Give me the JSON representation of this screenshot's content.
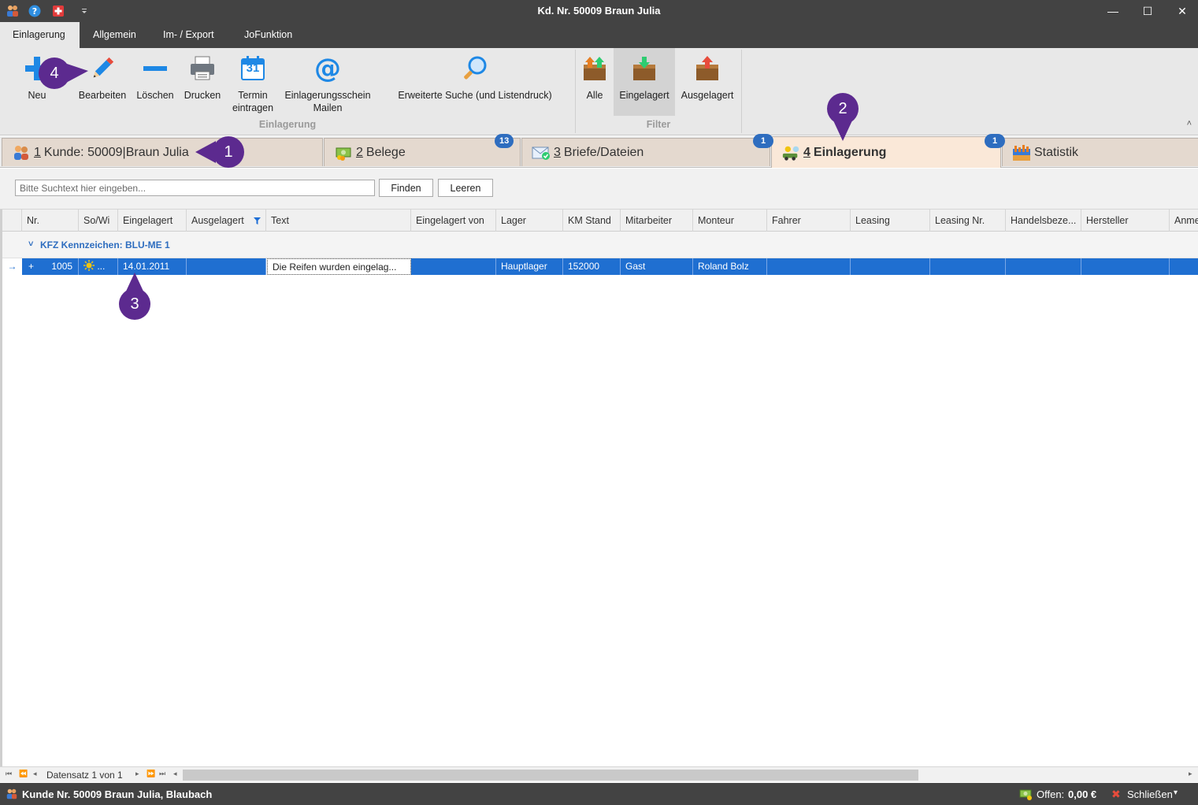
{
  "window": {
    "title": "Kd. Nr. 50009 Braun Julia",
    "minimize_glyph": "—",
    "maximize_glyph": "☐",
    "close_glyph": "✕"
  },
  "ribbon_tabs": [
    "Einlagerung",
    "Allgemein",
    "Im- / Export",
    "JoFunktion"
  ],
  "ribbon": {
    "group_einlagerung": {
      "label": "Einlagerung",
      "buttons": {
        "neu": "Neu",
        "bearbeiten": "Bearbeiten",
        "loeschen": "Löschen",
        "drucken": "Drucken",
        "termin_line1": "Termin",
        "termin_line2": "eintragen",
        "termin_day": "31",
        "mailen_line1": "Einlagerungsschein",
        "mailen_line2": "Mailen",
        "mail_glyph": "@",
        "suche": "Erweiterte Suche (und Listendruck)"
      }
    },
    "group_filter": {
      "label": "Filter",
      "buttons": {
        "alle": "Alle",
        "eingelagert": "Eingelagert",
        "ausgelagert": "Ausgelagert"
      },
      "selected": "Eingelagert"
    },
    "collapse_glyph": "˄"
  },
  "doc_tabs": [
    {
      "num": "1",
      "label": "Kunde: 50009|Braun Julia"
    },
    {
      "num": "2",
      "label": "Belege"
    },
    {
      "num": "3",
      "label": "Briefe/Dateien"
    },
    {
      "num": "4",
      "label": "Einlagerung"
    },
    {
      "num": "",
      "label": "Statistik"
    }
  ],
  "badges": {
    "belege": "13",
    "briefe": "1",
    "einlagerung": "1"
  },
  "search": {
    "placeholder": "Bitte Suchtext hier eingeben...",
    "find_label": "Finden",
    "clear_label": "Leeren"
  },
  "grid": {
    "columns": [
      "Nr.",
      "So/Wi",
      "Eingelagert",
      "Ausgelagert",
      "Text",
      "Eingelagert von",
      "Lager",
      "KM Stand",
      "Mitarbeiter",
      "Monteur",
      "Fahrer",
      "Leasing",
      "Leasing Nr.",
      "Handelsbeze...",
      "Hersteller",
      "Anme"
    ],
    "group_label": "KFZ Kennzeichen: BLU-ME 1",
    "group_chevron": "˅",
    "row_indicator": "→",
    "expand_glyph": "+",
    "rows": [
      {
        "nr": "1005",
        "sowi": "...",
        "eingelagert": "14.01.2011",
        "ausgelagert": "",
        "text": "Die Reifen wurden eingelag...",
        "eingelagert_von": "",
        "lager": "Hauptlager",
        "km_stand": "152000",
        "mitarbeiter": "Gast",
        "monteur": "Roland Bolz",
        "fahrer": "",
        "leasing": "",
        "leasing_nr": "",
        "handelsbez": "",
        "hersteller": ""
      }
    ]
  },
  "navigator": {
    "first": "⏮",
    "prev_page": "⏪",
    "prev": "◂",
    "record_text": "Datensatz 1 von 1",
    "next": "▸",
    "next_page": "⏩",
    "last": "⏭",
    "scroll_left": "◂",
    "scroll_right": "▸"
  },
  "status": {
    "customer": "Kunde Nr. 50009 Braun Julia, Blaubach",
    "offen_label": "Offen:",
    "offen_value": "0,00 €",
    "close_label": "Schließen",
    "close_glyph": "✖",
    "dropdown_glyph": "▾"
  },
  "markers": [
    "1",
    "2",
    "3",
    "4"
  ],
  "colors": {
    "titlebar": "#434343",
    "ribbon": "#e8e8e8",
    "selection": "#1f6fd1",
    "badge": "#2e6dbf",
    "marker": "#5c2a8f",
    "active_tab": "#fae8d8"
  }
}
